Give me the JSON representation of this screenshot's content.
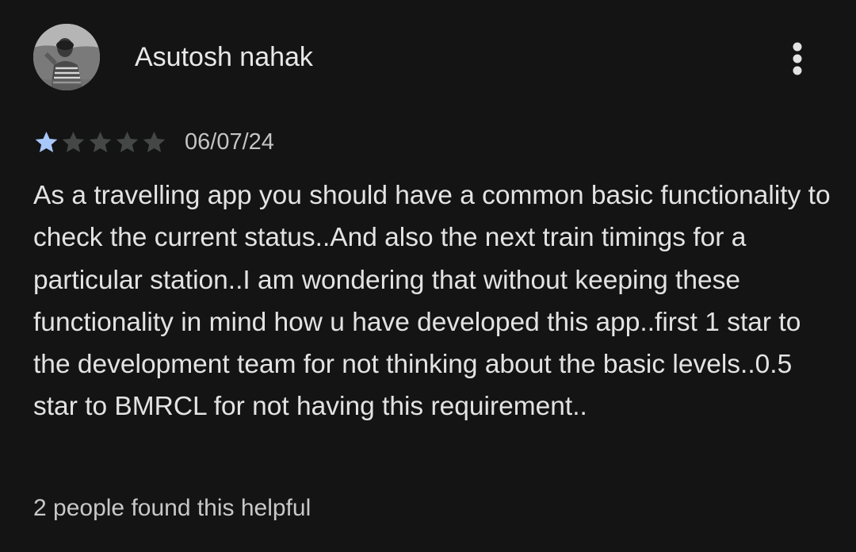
{
  "review": {
    "reviewer_name": "Asutosh nahak",
    "avatar_icon": "reviewer-photo-avatar",
    "menu_icon": "more-vert-icon",
    "rating": 1,
    "rating_max": 5,
    "date": "06/07/24",
    "text": "As a travelling app you should have a common basic functionality to check the current status..And also the next train timings for a particular station..I am wondering that without keeping these functionality in mind how u have developed this app..first 1 star to the development team for not thinking about the basic levels..0.5 star to BMRCL for not having this requirement..",
    "helpful": "2 people found this helpful"
  },
  "colors": {
    "background": "#141414",
    "star_filled": "#a8c7fa",
    "star_empty": "#444746",
    "text_primary": "#e3e3e3",
    "text_secondary": "#c4c4c4"
  }
}
